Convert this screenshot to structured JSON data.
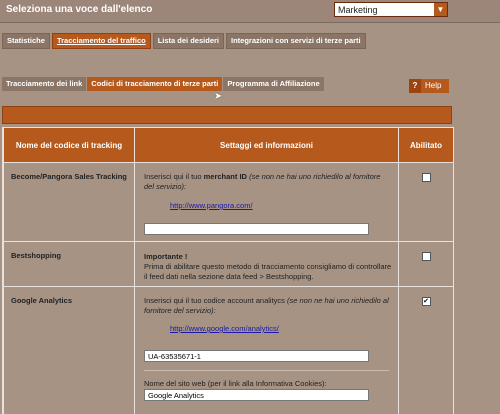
{
  "header": {
    "title": "Seleziona una voce dall'elenco",
    "select_value": "Marketing"
  },
  "main_tabs": [
    {
      "label": "Statistiche"
    },
    {
      "label": "Tracciamento del traffico"
    },
    {
      "label": "Lista dei desideri"
    },
    {
      "label": "Integrazioni con servizi di terze parti"
    }
  ],
  "sub_tabs": [
    {
      "label": "Tracciamento dei link"
    },
    {
      "label": "Codici di tracciamento di terze parti"
    },
    {
      "label": "Programma di Affiliazione"
    }
  ],
  "help_label": "Help",
  "table": {
    "headers": [
      "Nome del codice di tracking",
      "Settaggi ed informazioni",
      "Abilitato"
    ],
    "rows": [
      {
        "name": "Become/Pangora Sales Tracking",
        "intro": "Inserisci qui il tuo",
        "intro_bold": "merchant ID",
        "intro_italic": "(se non ne hai uno richiedilo al fornitore del servizio):",
        "link": "http://www.pangora.com/",
        "input_value": "",
        "enabled": false
      },
      {
        "name": "Bestshopping",
        "important": "Importante !",
        "text": "Prima di abilitare questo metodo di tracciamento consigliamo di controllare il feed dati nella sezione data feed > Bestshopping.",
        "enabled": false
      },
      {
        "name": "Google Analytics",
        "intro": "Inserisci qui il tuo codice account analitycs",
        "intro_italic": "(se non ne hai uno richiedilo al fornitore del servizio):",
        "link": "http://www.google.com/analytics/",
        "input_value": "UA-63535671-1",
        "site_label": "Nome del sito web (per il link alla Informativa Cookies):",
        "site_value": "Google Analytics",
        "enabled": true
      }
    ]
  }
}
